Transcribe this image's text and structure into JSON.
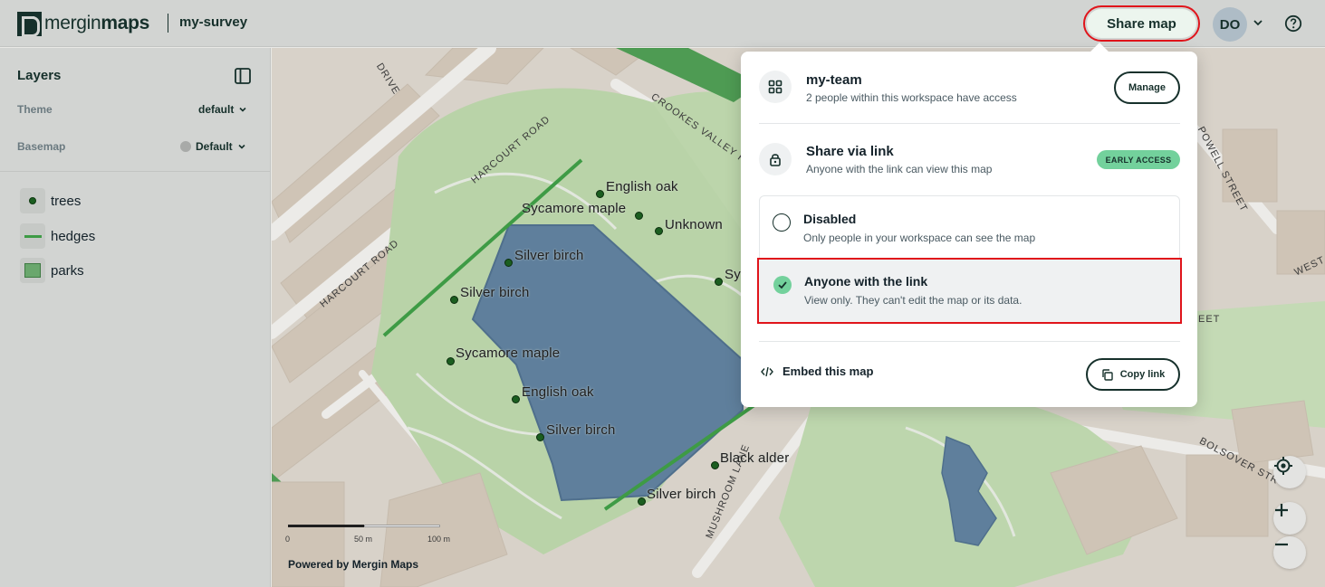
{
  "header": {
    "logo_text_light": "mergin",
    "logo_text_bold": "maps",
    "project_name": "my-survey",
    "share_button_label": "Share map",
    "avatar_initials": "DO"
  },
  "sidebar": {
    "title": "Layers",
    "theme_label": "Theme",
    "theme_value": "default",
    "basemap_label": "Basemap",
    "basemap_value": "Default",
    "layers": [
      {
        "label": "trees",
        "symbol": "point"
      },
      {
        "label": "hedges",
        "symbol": "line"
      },
      {
        "label": "parks",
        "symbol": "polygon"
      }
    ]
  },
  "map": {
    "streets": [
      "DRIVE",
      "HARCOURT ROAD",
      "HARCOURT ROAD",
      "CROOKES VALLEY RO",
      "POWELL STREET",
      "WEST",
      "BOLSOVER STR",
      "MUSHROOM LANE",
      "EET"
    ],
    "trees": [
      {
        "label": "English oak"
      },
      {
        "label": "Sycamore maple"
      },
      {
        "label": "Unknown"
      },
      {
        "label": "Silver birch"
      },
      {
        "label": "Silver birch"
      },
      {
        "label": "Sy"
      },
      {
        "label": "Sycamore maple"
      },
      {
        "label": "English oak"
      },
      {
        "label": "Silver birch"
      },
      {
        "label": "Black alder"
      },
      {
        "label": "Silver birch"
      }
    ],
    "scale": {
      "labels": [
        "0",
        "50 m",
        "100 m"
      ]
    },
    "attribution": "Powered by Mergin Maps",
    "colors": {
      "park": "#b7d2a5",
      "water": "#5d7e9b",
      "hedge": "#3e9b45",
      "building": "#d4c9bc",
      "land": "#ddd7ce"
    }
  },
  "share_dialog": {
    "workspace_name": "my-team",
    "workspace_access": "2 people within this workspace have access",
    "manage_label": "Manage",
    "link_title": "Share via link",
    "link_subtitle": "Anyone with the link can view this map",
    "badge": "EARLY ACCESS",
    "options": [
      {
        "title": "Disabled",
        "subtitle": "Only people in your workspace can see the map",
        "selected": false
      },
      {
        "title": "Anyone with the link",
        "subtitle": "View only. They can't edit the map or its data.",
        "selected": true
      }
    ],
    "embed_label": "Embed this map",
    "copy_label": "Copy link"
  },
  "colors": {
    "brand": "#16302b",
    "highlight": "#e0141b",
    "accent": "#73d19c"
  }
}
